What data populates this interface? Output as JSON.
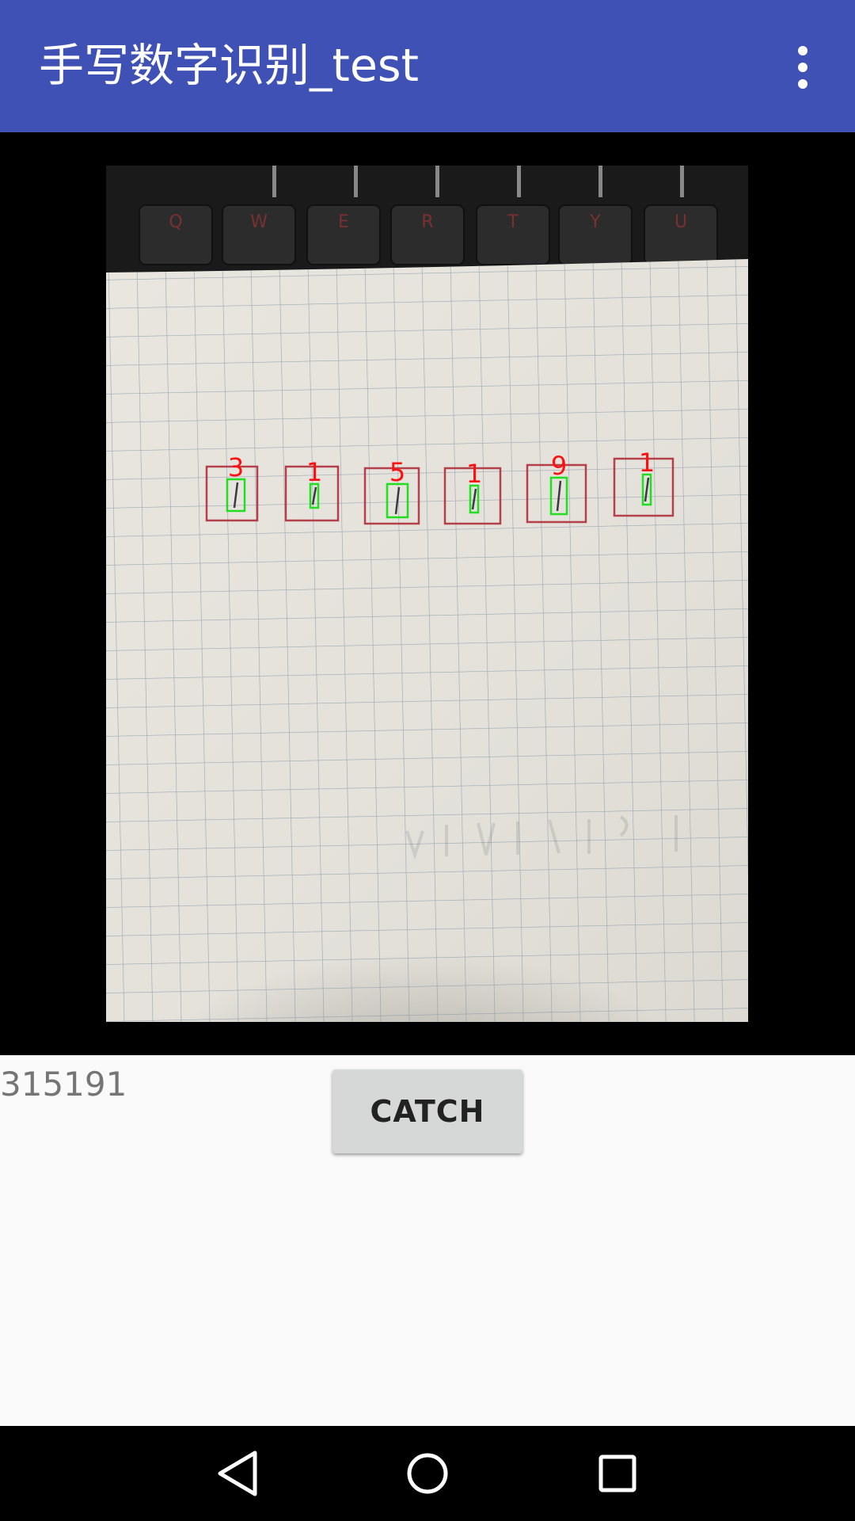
{
  "app_bar": {
    "title": "手写数字识别_test",
    "menu_icon": "more-vert-icon",
    "background_color": "#3F51B5"
  },
  "camera_preview": {
    "keyboard_keys": [
      "Q",
      "W",
      "E",
      "R",
      "T",
      "Y",
      "U"
    ],
    "detected_digits": [
      "3",
      "1",
      "5",
      "1",
      "9",
      "1"
    ],
    "box_color": "#B3404B",
    "highlight_color": "#22DD22",
    "label_color": "#FF1010"
  },
  "catch_button": {
    "label": "CATCH"
  },
  "result": {
    "text": "315191"
  },
  "nav_bar": {
    "back_icon": "back-triangle-icon",
    "home_icon": "home-circle-icon",
    "recents_icon": "recents-square-icon"
  }
}
